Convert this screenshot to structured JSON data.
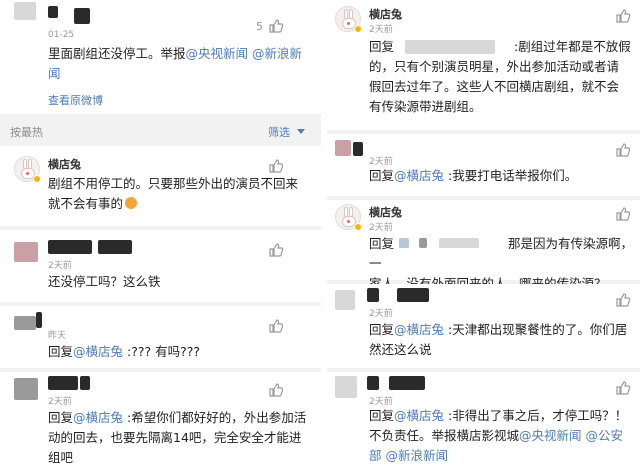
{
  "left": {
    "post": {
      "time": "01-25",
      "like_count": "5",
      "line1_text": "里面剧组还没停工。举报",
      "mention1": "@央视新闻",
      "mention2": "@新浪新",
      "line2_mention": "闻",
      "view_original": "查看原微博"
    },
    "section": {
      "sort_label": "按最热",
      "filter_label": "筛选"
    },
    "comments": [
      {
        "name": "横店兔",
        "line1": "剧组不用停工的。只要那些外出的演员不回来",
        "line2": "就不会有事的"
      },
      {
        "time": "2天前",
        "text": "还没停工吗？这么铁"
      },
      {
        "time": "昨天",
        "reply_prefix": "回复",
        "mention": "@横店兔",
        "text": " :??? 有吗???"
      },
      {
        "time": "2天前",
        "reply_prefix": "回复",
        "mention": "@横店兔",
        "line1_rest": " :希望你们都好好的，外出参加活",
        "line2": "动的回去，也要先隔离14吧，完全安全才能进",
        "line3": "组吧"
      }
    ]
  },
  "right": {
    "comments": [
      {
        "name": "横店兔",
        "time": "2天前",
        "reply_prefix": "回复",
        "line1_rest": ":剧组过年都是不放假",
        "line2": "的，只有个别演员明星，外出参加活动或者请",
        "line3": "假回去过年了。这些人不回横店剧组，就不会",
        "line4": "有传染源带进剧组。"
      },
      {
        "time": "2天前",
        "reply_prefix": "回复",
        "mention": "@横店兔",
        "text": " :我要打电话举报你们。"
      },
      {
        "name": "横店兔",
        "time": "2天前",
        "reply_prefix": "回复",
        "line1_rest": "那是因为有传染源啊，一",
        "line2": "家人，没有外面回来的人，哪来的传染源？"
      },
      {
        "time": "2天前",
        "reply_prefix": "回复",
        "mention": "@横店兔",
        "line1_rest": " :天津都出现聚餐性的了。你们居",
        "line2": "然还这么说"
      },
      {
        "time": "2天前",
        "reply_prefix": "回复",
        "mention": "@横店兔",
        "line1_rest": " :非得出了事之后，才停工吗？！",
        "line2_plain": "不负责任。举报横店影视城",
        "line2_m1": "@央视新闻",
        "line2_m2": " @公安",
        "line3_m1": "部",
        "line3_m2": " @新浪新闻"
      }
    ]
  },
  "colors": {
    "link": "#4f7cb5",
    "text": "#222222",
    "meta": "#9a9a9a",
    "bg": "#f2f2f2"
  },
  "icons": [
    "thumb-up-icon",
    "chevron-down-icon",
    "avatar-rabbit-icon",
    "verified-badge-icon"
  ]
}
